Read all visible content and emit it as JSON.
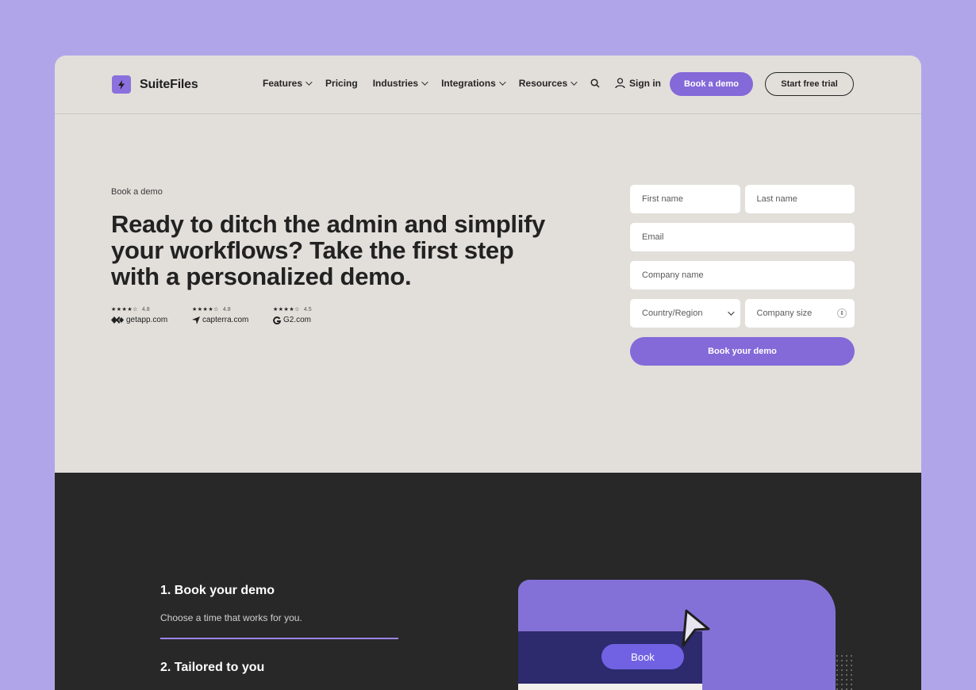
{
  "brand": {
    "name": "SuiteFiles",
    "accent": "#8469d9"
  },
  "nav": {
    "items": [
      {
        "label": "Features",
        "dropdown": true
      },
      {
        "label": "Pricing",
        "dropdown": false
      },
      {
        "label": "Industries",
        "dropdown": true
      },
      {
        "label": "Integrations",
        "dropdown": true
      },
      {
        "label": "Resources",
        "dropdown": true
      }
    ],
    "search_icon": "search-icon",
    "signin_label": "Sign in",
    "book_demo_label": "Book a demo",
    "trial_label": "Start free trial"
  },
  "hero": {
    "eyebrow": "Book a demo",
    "headline": "Ready to ditch the admin and simplify your workflows? Take the first step with a personalized demo.",
    "ratings": [
      {
        "stars": "★★★★☆",
        "score": "4.8",
        "source": "getapp.com",
        "icon": "getapp-icon"
      },
      {
        "stars": "★★★★☆",
        "score": "4.8",
        "source": "capterra.com",
        "icon": "capterra-icon"
      },
      {
        "stars": "★★★★☆",
        "score": "4.5",
        "source": "G2.com",
        "icon": "g2-icon"
      }
    ]
  },
  "form": {
    "first_name": "First name",
    "last_name": "Last name",
    "email": "Email",
    "company": "Company name",
    "country": "Country/Region",
    "size": "Company size",
    "submit": "Book your demo"
  },
  "steps": {
    "step1_title": "1. Book your demo",
    "step1_desc": "Choose a time that works for you.",
    "step2_title": "2. Tailored to you"
  },
  "illustration": {
    "button_label": "Book"
  }
}
